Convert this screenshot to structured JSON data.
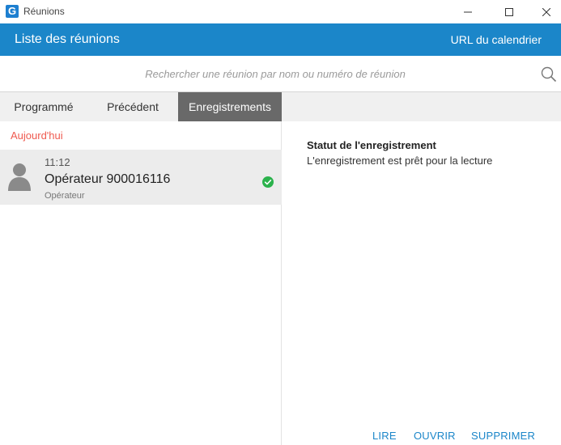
{
  "window": {
    "title": "Réunions",
    "app_icon_letter": "G"
  },
  "header": {
    "title": "Liste des réunions",
    "calendar_link": "URL du calendrier"
  },
  "search": {
    "placeholder": "Rechercher une réunion par nom ou numéro de réunion",
    "value": ""
  },
  "tabs": [
    {
      "label": "Programmé",
      "active": false
    },
    {
      "label": "Précédent",
      "active": false
    },
    {
      "label": "Enregistrements",
      "active": true
    }
  ],
  "list": {
    "section": "Aujourd'hui",
    "items": [
      {
        "time": "11:12",
        "name": "Opérateur 900016116",
        "subtitle": "Opérateur",
        "status_icon": "check-circle-icon",
        "status_color": "#2bb24c"
      }
    ]
  },
  "detail": {
    "status_title": "Statut de l'enregistrement",
    "status_text": "L'enregistrement est prêt pour la lecture",
    "actions": {
      "play": "LIRE",
      "open": "OUVRIR",
      "delete": "SUPPRIMER"
    }
  },
  "colors": {
    "header_blue": "#1b86c9",
    "active_tab": "#696969",
    "section_label": "#ef5a4f",
    "action_link": "#1b86c9"
  }
}
